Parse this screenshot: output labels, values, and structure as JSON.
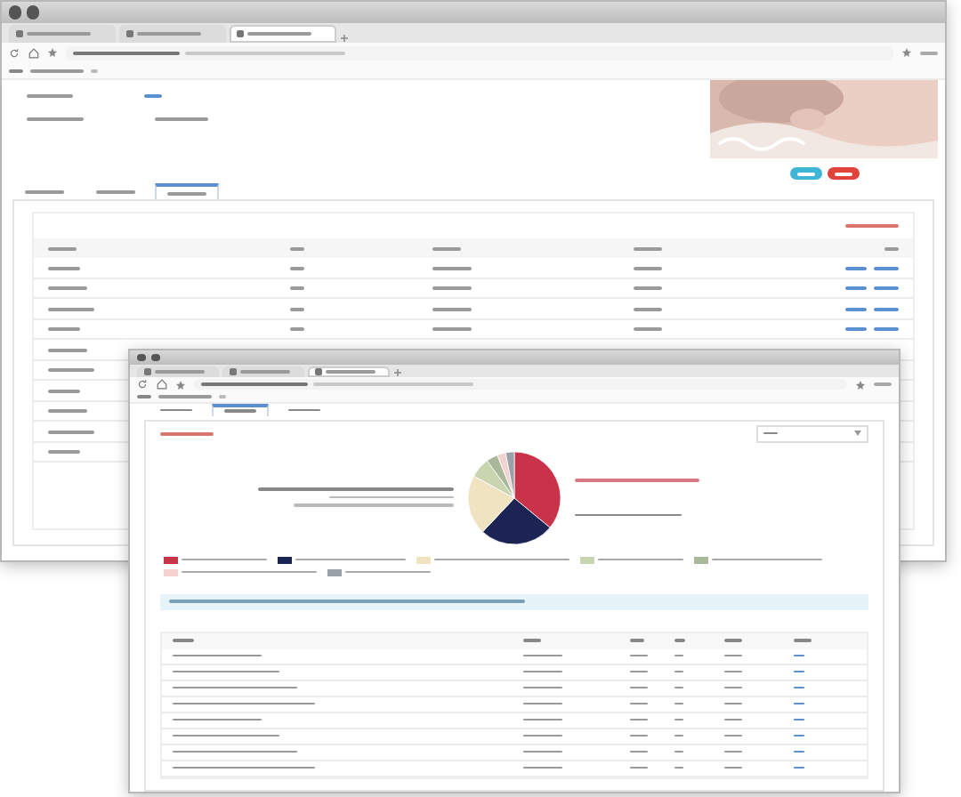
{
  "back_window": {
    "browser_tabs": [
      {
        "selected": false
      },
      {
        "selected": false
      },
      {
        "selected": true
      }
    ],
    "page_tabs": [
      {
        "selected": false
      },
      {
        "selected": false
      },
      {
        "selected": true
      }
    ],
    "buttons": [
      {
        "kind": "primary"
      },
      {
        "kind": "danger"
      }
    ],
    "table_rows": [
      {
        "kind": "row"
      },
      {
        "kind": "row"
      },
      {
        "kind": "row"
      },
      {
        "kind": "row"
      },
      {
        "kind": "row"
      },
      {
        "kind": "row"
      },
      {
        "kind": "row"
      },
      {
        "kind": "row"
      },
      {
        "kind": "row"
      },
      {
        "kind": "row"
      }
    ]
  },
  "front_window": {
    "browser_tabs": [
      {
        "selected": false
      },
      {
        "selected": false
      },
      {
        "selected": true
      }
    ],
    "page_tabs": [
      {
        "selected": false
      },
      {
        "selected": true
      },
      {
        "selected": false
      }
    ],
    "legend": [
      {
        "color": "#c8334a"
      },
      {
        "color": "#1b2452"
      },
      {
        "color": "#efe3c2"
      },
      {
        "color": "#c9d4b0"
      },
      {
        "color": "#a9b79a"
      },
      {
        "color": "#f2d3cf"
      },
      {
        "color": "#9aa0a8"
      }
    ],
    "table_rows": [
      {
        "kind": "row"
      },
      {
        "kind": "row"
      },
      {
        "kind": "row"
      },
      {
        "kind": "row"
      },
      {
        "kind": "row"
      },
      {
        "kind": "row"
      },
      {
        "kind": "row"
      },
      {
        "kind": "row"
      }
    ]
  }
}
